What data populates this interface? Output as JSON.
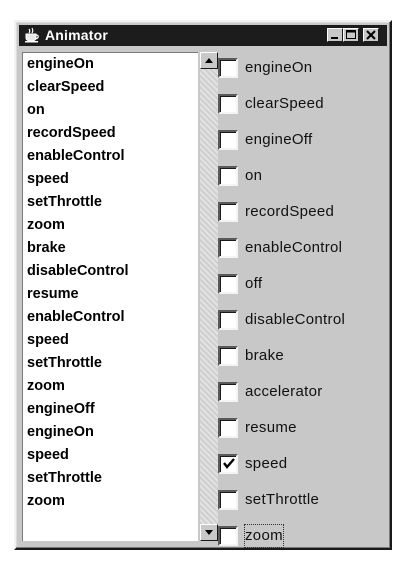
{
  "window": {
    "title": "Animator",
    "app_icon": "java-cup-icon",
    "controls": [
      "minimize-icon",
      "maximize-icon",
      "close-icon"
    ]
  },
  "event_list": {
    "items": [
      "engineOn",
      "clearSpeed",
      "on",
      "recordSpeed",
      "enableControl",
      "speed",
      "setThrottle",
      "zoom",
      "brake",
      "disableControl",
      "resume",
      "enableControl",
      "speed",
      "setThrottle",
      "zoom",
      "engineOff",
      "engineOn",
      "speed",
      "setThrottle",
      "zoom"
    ]
  },
  "scrollbar": {
    "up_icon": "arrow-up-icon",
    "down_icon": "arrow-down-icon"
  },
  "checkboxes": {
    "items": [
      {
        "label": "engineOn",
        "checked": false
      },
      {
        "label": "clearSpeed",
        "checked": false
      },
      {
        "label": "engineOff",
        "checked": false
      },
      {
        "label": "on",
        "checked": false
      },
      {
        "label": "recordSpeed",
        "checked": false
      },
      {
        "label": "enableControl",
        "checked": false
      },
      {
        "label": "off",
        "checked": false
      },
      {
        "label": "disableControl",
        "checked": false
      },
      {
        "label": "brake",
        "checked": false
      },
      {
        "label": "accelerator",
        "checked": false
      },
      {
        "label": "resume",
        "checked": false
      },
      {
        "label": "speed",
        "checked": true
      },
      {
        "label": "setThrottle",
        "checked": false
      },
      {
        "label": "zoom",
        "checked": false,
        "focused": true
      }
    ]
  },
  "colors": {
    "titlebar": "#1c1c1c",
    "window_bg": "#c8c8c8",
    "list_bg": "#ffffff"
  }
}
